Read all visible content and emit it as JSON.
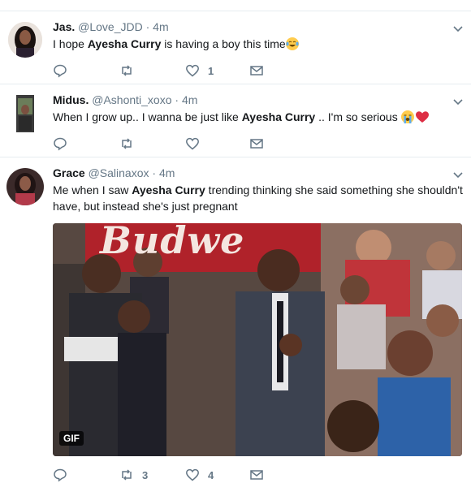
{
  "tweets": [
    {
      "name": "Jas.",
      "handle": "@Love_JDD",
      "time": "· 4m",
      "text_before": "I hope ",
      "text_bold": "Ayesha Curry",
      "text_after": " is having a boy this time",
      "emoji": [
        "tears-of-joy-emoji"
      ],
      "reply_count": "",
      "retweet_count": "",
      "like_count": "1"
    },
    {
      "name": "Midus.",
      "handle": "@Ashonti_xoxo",
      "time": "· 4m",
      "text_before": "When I grow up.. I wanna be just like ",
      "text_bold": "Ayesha Curry",
      "text_after": " .. I'm so serious ",
      "emoji": [
        "loudly-crying-emoji",
        "red-heart-emoji"
      ],
      "reply_count": "",
      "retweet_count": "",
      "like_count": ""
    },
    {
      "name": "Grace",
      "handle": "@Salinaxox",
      "time": "· 4m",
      "text_before": "Me when I saw ",
      "text_bold": "Ayesha Curry",
      "text_after": " trending thinking she said something she shouldn't have, but instead she's just pregnant",
      "media": {
        "badge": "GIF",
        "banner_text": "Budwe"
      },
      "reply_count": "",
      "retweet_count": "3",
      "like_count": "4"
    }
  ],
  "colors": {
    "text": "#14171a",
    "secondary": "#657786",
    "divider": "#e6ecf0",
    "heart": "#e0245e"
  }
}
